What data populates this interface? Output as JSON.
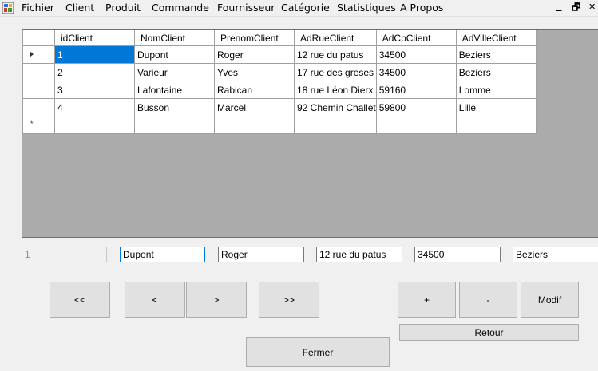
{
  "menu": {
    "items": [
      "Fichier",
      "Client",
      "Produit",
      "Commande",
      "Fournisseur",
      "Catégorie",
      "Statistiques",
      "A Propos"
    ],
    "window_controls": {
      "minimize": "_",
      "restore": "🗗",
      "close": "✕"
    }
  },
  "grid": {
    "columns": [
      "idClient",
      "NomClient",
      "PrenomClient",
      "AdRueClient",
      "AdCpClient",
      "AdVilleClient"
    ],
    "rows": [
      [
        "1",
        "Dupont",
        "Roger",
        "12 rue du patus",
        "34500",
        "Beziers"
      ],
      [
        "2",
        "Varieur",
        "Yves",
        "17 rue des greses",
        "34500",
        "Beziers"
      ],
      [
        "3",
        "Lafontaine",
        "Rabican",
        "18 rue Léon Dierx",
        "59160",
        "Lomme"
      ],
      [
        "4",
        "Busson",
        "Marcel",
        "92 Chemin Challet",
        "59800",
        "Lille"
      ]
    ],
    "new_row_marker": "*"
  },
  "fields": {
    "id": "1",
    "nom": "Dupont",
    "prenom": "Roger",
    "rue": "12 rue du patus",
    "cp": "34500",
    "ville": "Beziers"
  },
  "buttons": {
    "first": "<<",
    "prev": "<",
    "next": ">",
    "last": ">>",
    "add": "+",
    "delete": "-",
    "modif": "Modif",
    "retour": "Retour",
    "fermer": "Fermer"
  }
}
